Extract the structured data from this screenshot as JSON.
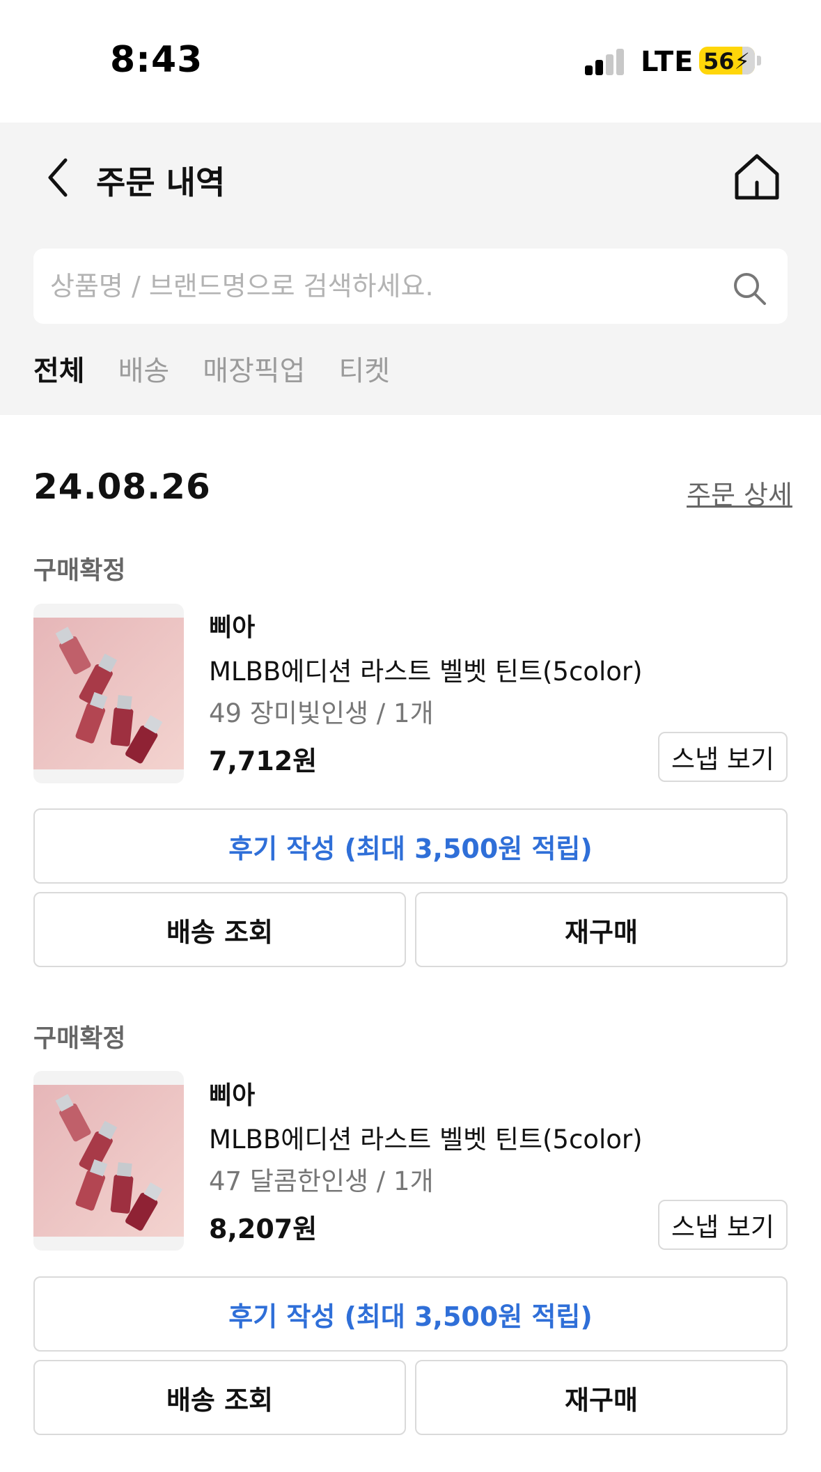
{
  "status_bar": {
    "time": "8:43",
    "network": "LTE",
    "battery": "56"
  },
  "header": {
    "title": "주문 내역"
  },
  "search": {
    "placeholder": "상품명 / 브랜드명으로 검색하세요."
  },
  "tabs": [
    {
      "label": "전체",
      "active": true
    },
    {
      "label": "배송",
      "active": false
    },
    {
      "label": "매장픽업",
      "active": false
    },
    {
      "label": "티켓",
      "active": false
    }
  ],
  "order": {
    "date": "24.08.26",
    "detail_link": "주문 상세",
    "items": [
      {
        "status": "구매확정",
        "brand": "삐아",
        "name": "MLBB에디션 라스트 벨벳 틴트(5color)",
        "option": "49 장미빛인생 / 1개",
        "price": "7,712원",
        "snap_label": "스냅 보기",
        "review_label": "후기 작성 (최대 3,500원 적립)",
        "delivery_label": "배송 조회",
        "rebuy_label": "재구매"
      },
      {
        "status": "구매확정",
        "brand": "삐아",
        "name": "MLBB에디션 라스트 벨벳 틴트(5color)",
        "option": "47 달콤한인생 / 1개",
        "price": "8,207원",
        "snap_label": "스냅 보기",
        "review_label": "후기 작성 (최대 3,500원 적립)",
        "delivery_label": "배송 조회",
        "rebuy_label": "재구매"
      }
    ]
  },
  "colors": {
    "accent_blue": "#2f6fd8",
    "header_bg": "#f4f4f4",
    "battery": "#ffd60a"
  },
  "icons": [
    "back-chevron-icon",
    "home-icon",
    "search-icon",
    "product-image"
  ]
}
